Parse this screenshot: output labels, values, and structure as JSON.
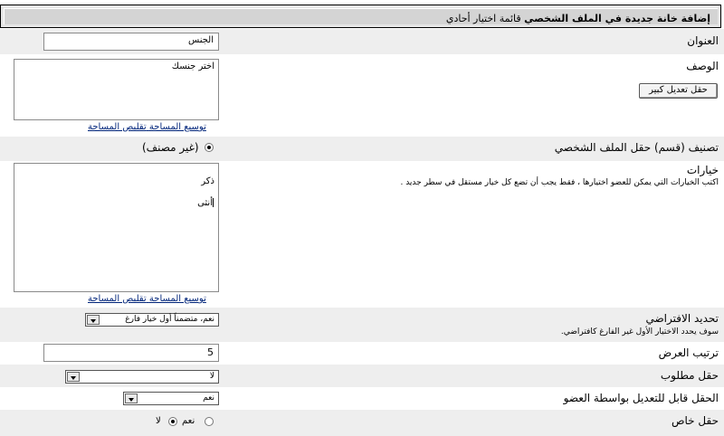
{
  "header": {
    "title": "إضافة خانة جديدة في الملف الشخصي",
    "subtitle": "قائمة اختيار أحادي"
  },
  "fields": {
    "title": {
      "label": "العنوان",
      "value": "الجنس"
    },
    "description": {
      "label": "الوصف",
      "value": "اختر جنسك",
      "big_edit_button": "حقل تعديل كبير",
      "expand_link": "توسيع المساحة",
      "shrink_link": "تقليص المساحة"
    },
    "category": {
      "label": "تصنيف (قسم) حقل الملف الشخصي",
      "option": "(غير مصنف)"
    },
    "options": {
      "label": "خيارات",
      "description": "اكتب الخيارات التي يمكن للعضو اختيارها ، فقط يجب أن تضع كل خيار مستقل في سطر جديد .",
      "line1": "ذكر",
      "line2": "أنثى",
      "expand_link": "توسيع المساحة",
      "shrink_link": "تقليص المساحة"
    },
    "default": {
      "label": "تحديد الافتراضي",
      "description": "سوف يحدد الاختيار الأول غير الفارغ كافتراضي.",
      "selected": "نعم، متضمناً أول خيار فارغ"
    },
    "display_order": {
      "label": "ترتيب العرض",
      "value": "5"
    },
    "required": {
      "label": "حقل مطلوب",
      "selected": "لا"
    },
    "editable": {
      "label": "الحقل قابل للتعديل بواسطة العضو",
      "selected": "نعم"
    },
    "private": {
      "label": "حقل خاص",
      "yes": "نعم",
      "no": "لا",
      "checked": "no"
    }
  }
}
